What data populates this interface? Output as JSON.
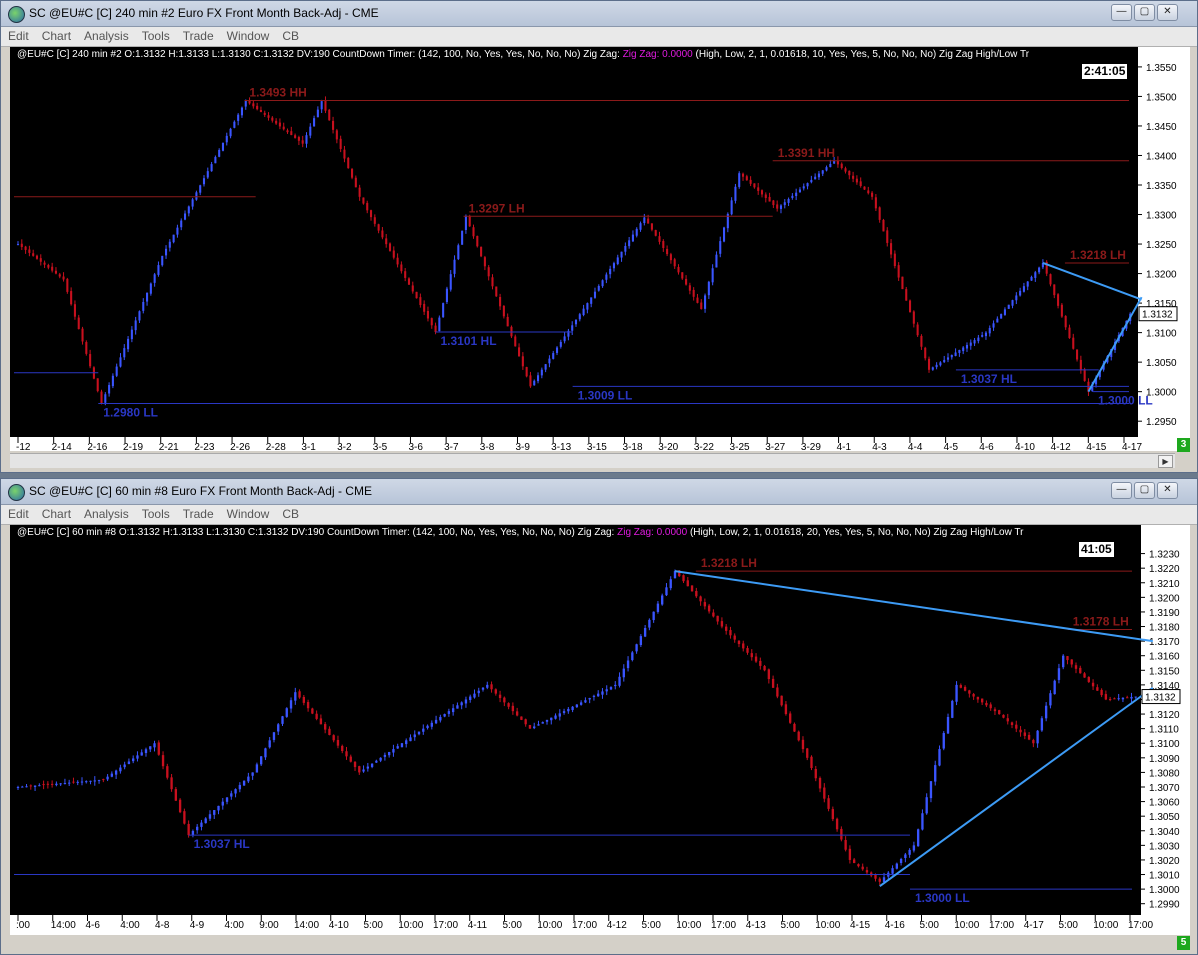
{
  "windows": [
    {
      "title": "SC @EU#C [C]  240 min   #2  Euro FX Front Month Back-Adj - CME",
      "menu": [
        "Edit",
        "Chart",
        "Analysis",
        "Tools",
        "Trade",
        "Window",
        "CB"
      ],
      "info": {
        "prefix": "@EU#C [C]  240 min   #2 O:1.3132 H:1.3133 L:1.3130 C:1.3132 DV:190  CountDown Timer:   (142, 100, No, Yes, Yes, No, No, No)  Zig Zag:",
        "zz": "Zig Zag: 0.0000",
        "suffix": "(High, Low, 2, 1, 0.01618, 10, Yes, Yes, 5, No, No, No)  Zig Zag High/Low Tr"
      },
      "timer": "2:41:05",
      "corner_badge": "3",
      "price_label": "1.3132"
    },
    {
      "title": "SC @EU#C [C]  60 min   #8  Euro FX Front Month Back-Adj - CME",
      "menu": [
        "Edit",
        "Chart",
        "Analysis",
        "Tools",
        "Trade",
        "Window",
        "CB"
      ],
      "info": {
        "prefix": "@EU#C [C]  60 min   #8 O:1.3132 H:1.3133 L:1.3130 C:1.3132 DV:190  CountDown Timer:   (142, 100, No, Yes, Yes, No, No, No)  Zig Zag:",
        "zz": "Zig Zag: 0.0000",
        "suffix": "(High, Low, 2, 1, 0.01618, 20, Yes, Yes, 5, No, No, No)  Zig Zag High/Low Tr"
      },
      "timer": "41:05",
      "corner_badge": "5",
      "price_label": "1.3132"
    }
  ],
  "chart_data": [
    {
      "type": "candlestick",
      "symbol": "@EU#C",
      "timeframe": "240 min",
      "ylim": [
        1.293,
        1.356
      ],
      "yticks": [
        1.295,
        1.3,
        1.305,
        1.31,
        1.315,
        1.32,
        1.325,
        1.33,
        1.335,
        1.34,
        1.345,
        1.35,
        1.355
      ],
      "ytick_labels": [
        "1.2950",
        "1.3000",
        "1.3050",
        "1.3100",
        "1.3150",
        "1.3200",
        "1.3250",
        "1.3300",
        "1.3350",
        "1.3400",
        "1.3450",
        "1.3500",
        "1.3550"
      ],
      "x_labels": [
        "-12",
        "2-14",
        "2-16",
        "2-19",
        "2-21",
        "2-23",
        "2-26",
        "2-28",
        "3-1",
        "3-2",
        "3-5",
        "3-6",
        "3-7",
        "3-8",
        "3-9",
        "3-13",
        "3-15",
        "3-18",
        "3-20",
        "3-22",
        "3-25",
        "3-27",
        "3-29",
        "4-1",
        "4-3",
        "4-4",
        "4-5",
        "4-6",
        "4-10",
        "4-12",
        "4-15",
        "4-17"
      ],
      "key_points": [
        {
          "bar": 0,
          "price": 1.325
        },
        {
          "bar": 12,
          "price": 1.319
        },
        {
          "bar": 22,
          "price": 1.298
        },
        {
          "bar": 38,
          "price": 1.323
        },
        {
          "bar": 60,
          "price": 1.3493
        },
        {
          "bar": 75,
          "price": 1.342
        },
        {
          "bar": 80,
          "price": 1.3492
        },
        {
          "bar": 90,
          "price": 1.333
        },
        {
          "bar": 110,
          "price": 1.3101
        },
        {
          "bar": 118,
          "price": 1.3297
        },
        {
          "bar": 135,
          "price": 1.3009
        },
        {
          "bar": 150,
          "price": 1.315
        },
        {
          "bar": 165,
          "price": 1.3295
        },
        {
          "bar": 180,
          "price": 1.314
        },
        {
          "bar": 190,
          "price": 1.337
        },
        {
          "bar": 200,
          "price": 1.331
        },
        {
          "bar": 215,
          "price": 1.3391
        },
        {
          "bar": 225,
          "price": 1.333
        },
        {
          "bar": 240,
          "price": 1.3037
        },
        {
          "bar": 255,
          "price": 1.31
        },
        {
          "bar": 270,
          "price": 1.3218
        },
        {
          "bar": 282,
          "price": 1.3
        },
        {
          "bar": 293,
          "price": 1.3132
        }
      ],
      "levels": [
        {
          "label": "1.3493 HH",
          "price": 1.3493,
          "type": "high",
          "from": 0.205,
          "to": 0.992
        },
        {
          "label": "1.3297 LH",
          "price": 1.3297,
          "type": "high",
          "from": 0.4,
          "to": 0.675
        },
        {
          "label": "1.3391 HH",
          "price": 1.3391,
          "type": "high",
          "from": 0.675,
          "to": 0.992
        },
        {
          "label": "1.3218 LH",
          "price": 1.3218,
          "type": "high",
          "from": 0.935,
          "to": 0.992
        },
        {
          "label": "",
          "price": 1.333,
          "type": "high",
          "from": 0.0,
          "to": 0.215
        },
        {
          "label": "1.3101 HL",
          "price": 1.3101,
          "type": "low",
          "from": 0.375,
          "to": 0.497
        },
        {
          "label": "1.3009 LL",
          "price": 1.3009,
          "type": "low",
          "from": 0.497,
          "to": 0.992
        },
        {
          "label": "1.3037 HL",
          "price": 1.3037,
          "type": "low",
          "from": 0.838,
          "to": 0.965
        },
        {
          "label": "1.2980 LL",
          "price": 1.298,
          "type": "low",
          "from": 0.075,
          "to": 0.992
        },
        {
          "label": "",
          "price": 1.3032,
          "type": "low",
          "from": 0.0,
          "to": 0.075
        },
        {
          "label": "1.3000 LL",
          "price": 1.3,
          "type": "low",
          "from": 0.96,
          "to": 0.992
        }
      ],
      "trendlines": [
        {
          "from": [
            270,
            1.3218
          ],
          "to": [
            296,
            1.3156
          ]
        },
        {
          "from": [
            282,
            1.3
          ],
          "to": [
            296,
            1.316
          ]
        }
      ],
      "current_price": 1.3132
    },
    {
      "type": "candlestick",
      "symbol": "@EU#C",
      "timeframe": "60 min",
      "ylim": [
        1.2985,
        1.324
      ],
      "yticks": [
        1.299,
        1.3,
        1.301,
        1.302,
        1.303,
        1.304,
        1.305,
        1.306,
        1.307,
        1.308,
        1.309,
        1.31,
        1.311,
        1.312,
        1.313,
        1.314,
        1.315,
        1.316,
        1.317,
        1.318,
        1.319,
        1.32,
        1.321,
        1.322,
        1.323
      ],
      "ytick_labels": [
        "1.2990",
        "1.3000",
        "1.3010",
        "1.3020",
        "1.3030",
        "1.3040",
        "1.3050",
        "1.3060",
        "1.3070",
        "1.3080",
        "1.3090",
        "1.3100",
        "1.3110",
        "1.3120",
        "1.3130",
        "1.3140",
        "1.3150",
        "1.3160",
        "1.3170",
        "1.3180",
        "1.3190",
        "1.3200",
        "1.3210",
        "1.3220",
        "1.3230"
      ],
      "x_labels": [
        ":00",
        "14:00",
        "4-6",
        "4:00",
        "4-8",
        "4-9",
        "4:00",
        "9:00",
        "14:00",
        "4-10",
        "5:00",
        "10:00",
        "17:00",
        "4-11",
        "5:00",
        "10:00",
        "17:00",
        "4-12",
        "5:00",
        "10:00",
        "17:00",
        "4-13",
        "5:00",
        "10:00",
        "4-15",
        "4-16",
        "5:00",
        "10:00",
        "17:00",
        "4-17",
        "5:00",
        "10:00",
        "17:00"
      ],
      "key_points": [
        {
          "bar": 0,
          "price": 1.307
        },
        {
          "bar": 20,
          "price": 1.3075
        },
        {
          "bar": 32,
          "price": 1.31
        },
        {
          "bar": 40,
          "price": 1.3037
        },
        {
          "bar": 55,
          "price": 1.308
        },
        {
          "bar": 65,
          "price": 1.3135
        },
        {
          "bar": 80,
          "price": 1.308
        },
        {
          "bar": 95,
          "price": 1.311
        },
        {
          "bar": 110,
          "price": 1.314
        },
        {
          "bar": 120,
          "price": 1.311
        },
        {
          "bar": 140,
          "price": 1.314
        },
        {
          "bar": 154,
          "price": 1.3218
        },
        {
          "bar": 165,
          "price": 1.318
        },
        {
          "bar": 175,
          "price": 1.315
        },
        {
          "bar": 185,
          "price": 1.309
        },
        {
          "bar": 195,
          "price": 1.302
        },
        {
          "bar": 202,
          "price": 1.3005
        },
        {
          "bar": 210,
          "price": 1.303
        },
        {
          "bar": 220,
          "price": 1.314
        },
        {
          "bar": 230,
          "price": 1.312
        },
        {
          "bar": 238,
          "price": 1.31
        },
        {
          "bar": 245,
          "price": 1.316
        },
        {
          "bar": 255,
          "price": 1.313
        },
        {
          "bar": 262,
          "price": 1.3132
        }
      ],
      "levels": [
        {
          "label": "1.3218 LH",
          "price": 1.3218,
          "type": "high",
          "from": 0.605,
          "to": 0.992
        },
        {
          "label": "1.3178 LH",
          "price": 1.3178,
          "type": "high",
          "from": 0.935,
          "to": 0.992
        },
        {
          "label": "1.3037 HL",
          "price": 1.3037,
          "type": "low",
          "from": 0.155,
          "to": 0.795
        },
        {
          "label": "",
          "price": 1.301,
          "type": "low",
          "from": 0.0,
          "to": 0.795
        },
        {
          "label": "1.3000 LL",
          "price": 1.3,
          "type": "low",
          "from": 0.795,
          "to": 0.992
        }
      ],
      "trendlines": [
        {
          "from": [
            154,
            1.3218
          ],
          "to": [
            266,
            1.317
          ]
        },
        {
          "from": [
            202,
            1.3002
          ],
          "to": [
            266,
            1.3138
          ]
        }
      ],
      "current_price": 1.3132
    }
  ],
  "colors": {
    "up_candle": "#3a55ff",
    "down_candle": "#c8101e",
    "high_level": "#8b1a1a",
    "low_level": "#2a37c4",
    "trendline": "#3d9bf5",
    "background": "#000000",
    "axis_text": "#000000"
  }
}
